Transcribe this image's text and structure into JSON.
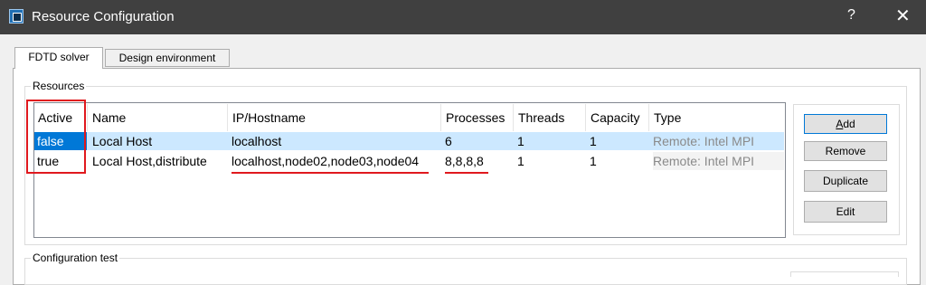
{
  "window": {
    "title": "Resource Configuration",
    "help": "?",
    "close": "✕"
  },
  "tabs": [
    {
      "label": "FDTD solver",
      "active": true
    },
    {
      "label": "Design environment",
      "active": false
    }
  ],
  "resources": {
    "legend": "Resources",
    "columns": [
      "Active",
      "Name",
      "IP/Hostname",
      "Processes",
      "Threads",
      "Capacity",
      "Type"
    ],
    "rows": [
      {
        "active": "false",
        "name": "Local Host",
        "host": "localhost",
        "processes": "6",
        "threads": "1",
        "capacity": "1",
        "type": "Remote: Intel MPI"
      },
      {
        "active": "true",
        "name": "Local Host,distribute",
        "host": "localhost,node02,node03,node04",
        "processes": "8,8,8,8",
        "threads": "1",
        "capacity": "1",
        "type": "Remote: Intel MPI"
      }
    ],
    "buttons": {
      "add_first": "A",
      "add_rest": "dd",
      "remove": "Remove",
      "duplicate": "Duplicate",
      "edit": "Edit"
    }
  },
  "config_test": {
    "legend": "Configuration test"
  },
  "colors": {
    "selection": "#cce8ff",
    "active_cell": "#0078d7",
    "annotation": "#e0191e",
    "titlebar": "#404040"
  }
}
